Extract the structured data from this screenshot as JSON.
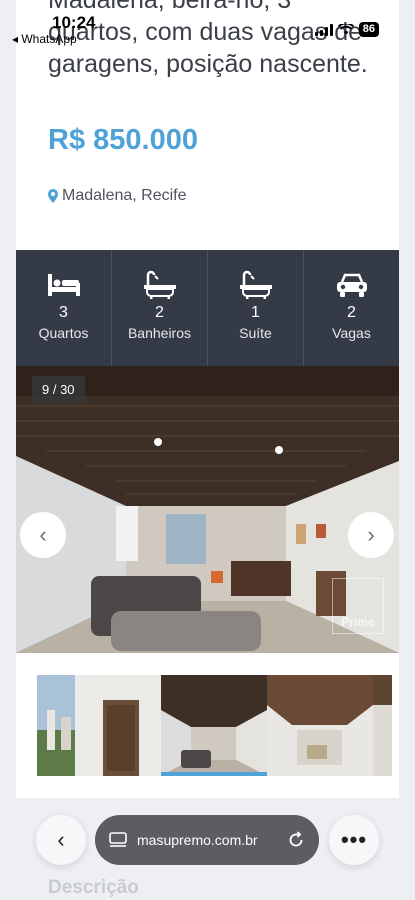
{
  "status": {
    "time": "10:24",
    "back_app": "◂ WhatsApp",
    "battery": "86"
  },
  "listing": {
    "title": "Madalena, beira-rio, 3 quartos, com duas vagas de garagens, posição nascente.",
    "price": "R$ 850.000",
    "location": "Madalena, Recife"
  },
  "features": [
    {
      "icon": "bed-icon",
      "value": "3",
      "label": "Quartos"
    },
    {
      "icon": "bathtub-icon",
      "value": "2",
      "label": "Banheiros"
    },
    {
      "icon": "bathtub-icon",
      "value": "1",
      "label": "Suíte"
    },
    {
      "icon": "car-icon",
      "value": "2",
      "label": "Vagas"
    }
  ],
  "gallery": {
    "counter": "9 / 30",
    "watermark": "Prime",
    "prev": "‹",
    "next": "›"
  },
  "browser": {
    "url": "masupremo.com.br",
    "back": "‹",
    "more": "•••"
  },
  "section": {
    "description_heading": "Descrição"
  }
}
